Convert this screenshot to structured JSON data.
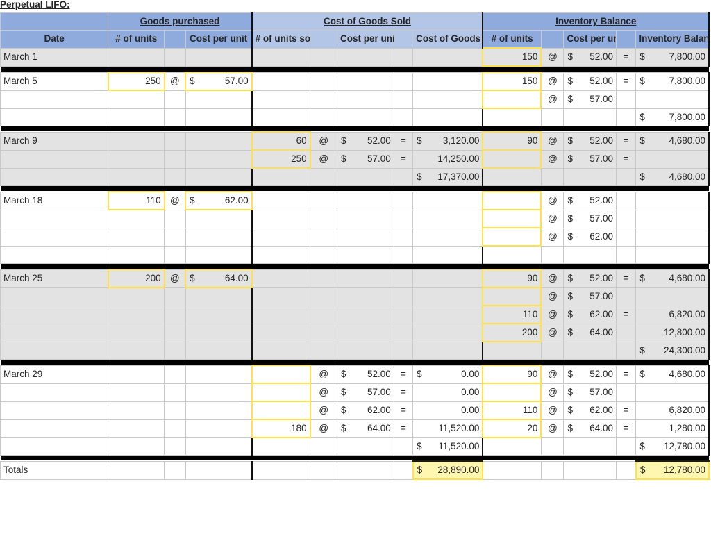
{
  "title": "Perpetual LIFO:",
  "colors": {
    "header_dark": "#8FAADC",
    "header_light": "#B4C6E7",
    "band_gray": "#E3E3E3",
    "input_border": "#FFE14D",
    "input_fill": "#FFF7B0"
  },
  "header": {
    "groups": {
      "goods_purchased": "Goods purchased",
      "cost_of_goods_sold": "Cost of Goods Sold",
      "inventory_balance": "Inventory Balance"
    },
    "columns": {
      "date": "Date",
      "gp_units": "# of units",
      "gp_cost_per_unit": "Cost per unit",
      "cogs_units_sold": "# of units sold",
      "cogs_cost_per_unit": "Cost per unit",
      "cogs_total": "Cost of Goods Sold",
      "inv_units": "# of units",
      "inv_cost_per_unit": "Cost per unit",
      "inv_balance": "Inventory Balance"
    }
  },
  "symbols": {
    "at": "@",
    "equals": "=",
    "currency": "$"
  },
  "totals_label": "Totals",
  "blocks": [
    {
      "date": "March 1",
      "band": "gray",
      "rows": [
        {
          "gp_units": "",
          "gp_at": "",
          "gp_cpu": "",
          "cogs_units": "",
          "cogs_at": "",
          "cogs_cpu": "",
          "cogs_eq": "",
          "cogs_cur": "",
          "cogs_amt": "",
          "inv_units": "150",
          "inv_at": "@",
          "inv_cur": "$",
          "inv_cpu": "52.00",
          "inv_eq": "=",
          "inv_bal_cur": "$",
          "inv_bal": "7,800.00"
        }
      ]
    },
    {
      "date": "March 5",
      "band": "white",
      "rows": [
        {
          "gp_units": "250",
          "gp_at": "@",
          "gp_cur": "$",
          "gp_cpu": "57.00",
          "cogs_units": "",
          "cogs_at": "",
          "cogs_cpu": "",
          "cogs_eq": "",
          "cogs_amt": "",
          "inv_units": "150",
          "inv_at": "@",
          "inv_cur": "$",
          "inv_cpu": "52.00",
          "inv_eq": "=",
          "inv_bal_cur": "$",
          "inv_bal": "7,800.00"
        },
        {
          "gp_units": "",
          "gp_at": "",
          "gp_cpu": "",
          "cogs_units": "",
          "cogs_at": "",
          "cogs_cpu": "",
          "cogs_eq": "",
          "cogs_amt": "",
          "inv_units": "",
          "inv_at": "@",
          "inv_cur": "$",
          "inv_cpu": "57.00",
          "inv_eq": "",
          "inv_bal": ""
        },
        {
          "gp_units": "",
          "gp_at": "",
          "gp_cpu": "",
          "cogs_units": "",
          "cogs_at": "",
          "cogs_cpu": "",
          "cogs_eq": "",
          "cogs_amt": "",
          "inv_units": "",
          "inv_at": "",
          "inv_cpu": "",
          "inv_eq": "",
          "inv_bal_cur": "$",
          "inv_bal": "7,800.00"
        }
      ]
    },
    {
      "date": "March 9",
      "band": "gray",
      "rows": [
        {
          "gp_units": "",
          "gp_at": "",
          "gp_cpu": "",
          "cogs_units": "60",
          "cogs_at": "@",
          "cogs_cur": "$",
          "cogs_cpu": "52.00",
          "cogs_eq": "=",
          "cogs_amt_cur": "$",
          "cogs_amt": "3,120.00",
          "inv_units": "90",
          "inv_at": "@",
          "inv_cur": "$",
          "inv_cpu": "52.00",
          "inv_eq": "=",
          "inv_bal_cur": "$",
          "inv_bal": "4,680.00"
        },
        {
          "gp_units": "",
          "gp_at": "",
          "gp_cpu": "",
          "cogs_units": "250",
          "cogs_at": "@",
          "cogs_cur": "$",
          "cogs_cpu": "57.00",
          "cogs_eq": "=",
          "cogs_amt": "14,250.00",
          "inv_units": "",
          "inv_at": "@",
          "inv_cur": "$",
          "inv_cpu": "57.00",
          "inv_eq": "=",
          "inv_bal": ""
        },
        {
          "gp_units": "",
          "gp_at": "",
          "gp_cpu": "",
          "cogs_units": "",
          "cogs_at": "",
          "cogs_cpu": "",
          "cogs_eq": "",
          "cogs_amt_cur": "$",
          "cogs_amt": "17,370.00",
          "inv_units": "",
          "inv_at": "",
          "inv_cpu": "",
          "inv_eq": "",
          "inv_bal_cur": "$",
          "inv_bal": "4,680.00"
        }
      ]
    },
    {
      "date": "March 18",
      "band": "white",
      "rows": [
        {
          "gp_units": "110",
          "gp_at": "@",
          "gp_cur": "$",
          "gp_cpu": "62.00",
          "cogs_units": "",
          "cogs_at": "",
          "cogs_cpu": "",
          "cogs_eq": "",
          "cogs_amt": "",
          "inv_units": "",
          "inv_at": "@",
          "inv_cur": "$",
          "inv_cpu": "52.00",
          "inv_eq": "",
          "inv_bal": ""
        },
        {
          "gp_units": "",
          "gp_at": "",
          "gp_cpu": "",
          "cogs_units": "",
          "cogs_at": "",
          "cogs_cpu": "",
          "cogs_eq": "",
          "cogs_amt": "",
          "inv_units": "",
          "inv_at": "@",
          "inv_cur": "$",
          "inv_cpu": "57.00",
          "inv_eq": "",
          "inv_bal": ""
        },
        {
          "gp_units": "",
          "gp_at": "",
          "gp_cpu": "",
          "cogs_units": "",
          "cogs_at": "",
          "cogs_cpu": "",
          "cogs_eq": "",
          "cogs_amt": "",
          "inv_units": "",
          "inv_at": "@",
          "inv_cur": "$",
          "inv_cpu": "62.00",
          "inv_eq": "",
          "inv_bal": ""
        },
        {
          "gp_units": "",
          "gp_at": "",
          "gp_cpu": "",
          "cogs_units": "",
          "cogs_at": "",
          "cogs_cpu": "",
          "cogs_eq": "",
          "cogs_amt": "",
          "inv_units": "",
          "inv_at": "",
          "inv_cpu": "",
          "inv_eq": "",
          "inv_bal": ""
        }
      ]
    },
    {
      "date": "March 25",
      "band": "gray",
      "rows": [
        {
          "gp_units": "200",
          "gp_at": "@",
          "gp_cur": "$",
          "gp_cpu": "64.00",
          "cogs_units": "",
          "cogs_at": "",
          "cogs_cpu": "",
          "cogs_eq": "",
          "cogs_amt": "",
          "inv_units": "90",
          "inv_at": "@",
          "inv_cur": "$",
          "inv_cpu": "52.00",
          "inv_eq": "=",
          "inv_bal_cur": "$",
          "inv_bal": "4,680.00"
        },
        {
          "gp_units": "",
          "gp_at": "",
          "gp_cpu": "",
          "cogs_units": "",
          "cogs_at": "",
          "cogs_cpu": "",
          "cogs_eq": "",
          "cogs_amt": "",
          "inv_units": "",
          "inv_at": "@",
          "inv_cur": "$",
          "inv_cpu": "57.00",
          "inv_eq": "",
          "inv_bal": ""
        },
        {
          "gp_units": "",
          "gp_at": "",
          "gp_cpu": "",
          "cogs_units": "",
          "cogs_at": "",
          "cogs_cpu": "",
          "cogs_eq": "",
          "cogs_amt": "",
          "inv_units": "110",
          "inv_at": "@",
          "inv_cur": "$",
          "inv_cpu": "62.00",
          "inv_eq": "=",
          "inv_bal": "6,820.00"
        },
        {
          "gp_units": "",
          "gp_at": "",
          "gp_cpu": "",
          "cogs_units": "",
          "cogs_at": "",
          "cogs_cpu": "",
          "cogs_eq": "",
          "cogs_amt": "",
          "inv_units": "200",
          "inv_at": "@",
          "inv_cur": "$",
          "inv_cpu": "64.00",
          "inv_eq": "",
          "inv_bal": "12,800.00"
        },
        {
          "gp_units": "",
          "gp_at": "",
          "gp_cpu": "",
          "cogs_units": "",
          "cogs_at": "",
          "cogs_cpu": "",
          "cogs_eq": "",
          "cogs_amt": "",
          "inv_units": "",
          "inv_at": "",
          "inv_cpu": "",
          "inv_eq": "",
          "inv_bal_cur": "$",
          "inv_bal": "24,300.00"
        }
      ]
    },
    {
      "date": "March 29",
      "band": "white",
      "rows": [
        {
          "gp_units": "",
          "gp_at": "",
          "gp_cpu": "",
          "cogs_units": "",
          "cogs_at": "@",
          "cogs_cur": "$",
          "cogs_cpu": "52.00",
          "cogs_eq": "=",
          "cogs_amt_cur": "$",
          "cogs_amt": "0.00",
          "inv_units": "90",
          "inv_at": "@",
          "inv_cur": "$",
          "inv_cpu": "52.00",
          "inv_eq": "=",
          "inv_bal_cur": "$",
          "inv_bal": "4,680.00"
        },
        {
          "gp_units": "",
          "gp_at": "",
          "gp_cpu": "",
          "cogs_units": "",
          "cogs_at": "@",
          "cogs_cur": "$",
          "cogs_cpu": "57.00",
          "cogs_eq": "=",
          "cogs_amt": "0.00",
          "inv_units": "",
          "inv_at": "@",
          "inv_cur": "$",
          "inv_cpu": "57.00",
          "inv_eq": "",
          "inv_bal": ""
        },
        {
          "gp_units": "",
          "gp_at": "",
          "gp_cpu": "",
          "cogs_units": "",
          "cogs_at": "@",
          "cogs_cur": "$",
          "cogs_cpu": "62.00",
          "cogs_eq": "=",
          "cogs_amt": "0.00",
          "inv_units": "110",
          "inv_at": "@",
          "inv_cur": "$",
          "inv_cpu": "62.00",
          "inv_eq": "=",
          "inv_bal": "6,820.00"
        },
        {
          "gp_units": "",
          "gp_at": "",
          "gp_cpu": "",
          "cogs_units": "180",
          "cogs_at": "@",
          "cogs_cur": "$",
          "cogs_cpu": "64.00",
          "cogs_eq": "=",
          "cogs_amt": "11,520.00",
          "inv_units": "20",
          "inv_at": "@",
          "inv_cur": "$",
          "inv_cpu": "64.00",
          "inv_eq": "=",
          "inv_bal": "1,280.00"
        },
        {
          "gp_units": "",
          "gp_at": "",
          "gp_cpu": "",
          "cogs_units": "",
          "cogs_at": "",
          "cogs_cpu": "",
          "cogs_eq": "",
          "cogs_amt_cur": "$",
          "cogs_amt": "11,520.00",
          "inv_units": "",
          "inv_at": "",
          "inv_cpu": "",
          "inv_eq": "",
          "inv_bal_cur": "$",
          "inv_bal": "12,780.00"
        }
      ]
    }
  ],
  "totals": {
    "label": "Totals",
    "cogs_cur": "$",
    "cogs_amt": "28,890.00",
    "inv_cur": "$",
    "inv_bal": "12,780.00"
  }
}
